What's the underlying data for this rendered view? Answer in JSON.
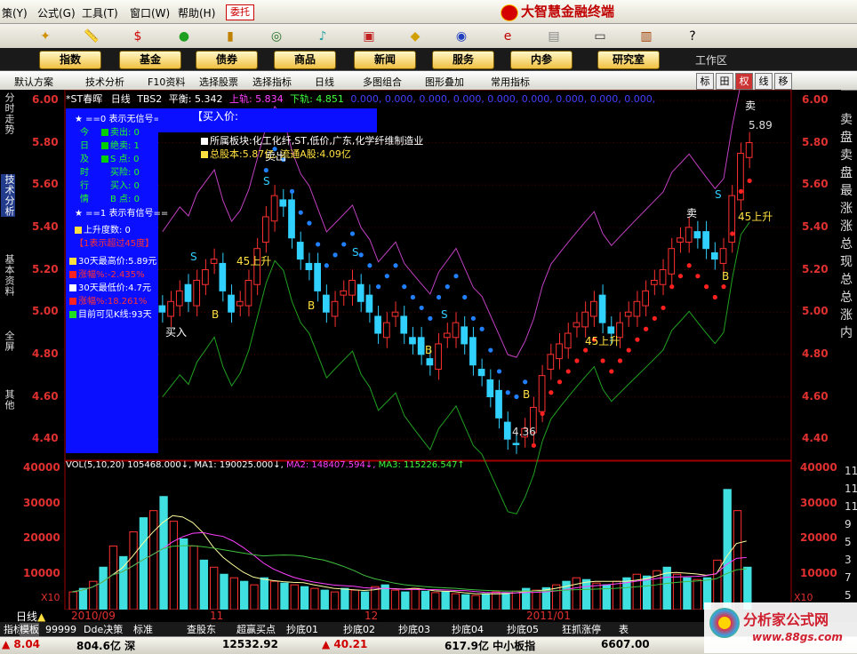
{
  "menubar": {
    "items": [
      "策(Y)",
      "公式(G)",
      "工具(T)",
      "窗口(W)",
      "帮助(H)"
    ],
    "entrust_label": "委托",
    "brand": "大智慧金融终端"
  },
  "toolbar": {
    "icons": [
      "nav-diamond",
      "ruler",
      "dollar-sign",
      "traffic-light",
      "bars-gold",
      "binoculars",
      "bell",
      "book",
      "diamond",
      "globe",
      "coin-e",
      "clipboard",
      "window",
      "books",
      "help-pointer"
    ]
  },
  "navbar": {
    "tabs": [
      "指数",
      "基金",
      "债券",
      "商品",
      "新闻",
      "服务",
      "内参",
      "研究室"
    ],
    "workspace_label": "工作区"
  },
  "subbar": {
    "items": [
      "默认方案",
      "技术分析",
      "F10资料",
      "选择股票",
      "选择指标",
      "日线",
      "多图组合",
      "图形叠加",
      "常用指标"
    ],
    "right_buttons": [
      "标",
      "田",
      "权",
      "线",
      "移"
    ]
  },
  "left_tabs": [
    "分时走势",
    "技术分析",
    "基本资料",
    "全屏",
    "其他"
  ],
  "main_chart": {
    "header": {
      "name": "*ST春晖",
      "period": "日线",
      "indicator": "TBS2",
      "avg_label": "平衡: 5.342",
      "upper_label": "上轨: 5.834",
      "lower_label": "下轨: 4.851",
      "zeros": "0.000, 0.000, 0.000, 0.000, 0.000, 0.000, 0.000, 0.000, 0.000,"
    },
    "y_ticks": [
      "6.00",
      "5.80",
      "5.60",
      "5.40",
      "5.20",
      "5.00",
      "4.80",
      "4.60",
      "4.40"
    ],
    "price_max_label": "5.89",
    "price_min_label": "4.36",
    "annotations": {
      "sell": "卖出",
      "buy": "买入",
      "rise45": "45上升",
      "sell_short": "卖",
      "buy_b": "B",
      "sell_s": "S"
    }
  },
  "info_box": {
    "line1": "★ ==0 表示无信号==",
    "left_chars": [
      "今",
      "日",
      "及",
      "时",
      "行",
      "情"
    ],
    "rows": [
      {
        "label": "卖出",
        "value": "0",
        "color": "#00d000"
      },
      {
        "label": "绝卖",
        "value": "1",
        "color": "#00d000"
      },
      {
        "label": "S 点",
        "value": "0",
        "color": "#00d000"
      },
      {
        "label": "买险",
        "value": "0",
        "color": "#0a10ff"
      },
      {
        "label": "买入",
        "value": "0",
        "color": "#0a10ff"
      },
      {
        "label": "B 点",
        "value": "0",
        "color": "#0a10ff"
      }
    ],
    "line2": "★ ==1 表示有信号==",
    "rise_degree": "上升度数: 0",
    "over45": "【1表示超过45度】",
    "high30": "30天最高价:5.89元",
    "up_pct": "涨幅%:-2.435%",
    "low30": "30天最低价:4.7元",
    "up_pct2": "涨幅%:18.261%",
    "visible_k": "目前可见K线:93天"
  },
  "buy_banner": {
    "title": "【买入价:",
    "sector": "所属板块:化工化纤,ST,低价,广东,化学纤维制造业",
    "equity": "总股本:5.87亿, 流通A股:4.09亿"
  },
  "volume_chart": {
    "header": {
      "vol": "VOL(5,10,20) 105468.000↓,",
      "ma1": "MA1: 190025.000↓,",
      "ma2": "MA2: 148407.594↓,",
      "ma3": "MA3: 115226.547↑"
    },
    "y_ticks": [
      "40000",
      "30000",
      "20000",
      "10000"
    ],
    "x10": "X10",
    "dates": [
      "2010/09",
      "11",
      "12",
      "2011/01"
    ],
    "right_values": [
      "11",
      "11",
      "11",
      "9",
      "5",
      "3",
      "7",
      "5"
    ]
  },
  "bottom_tabs": {
    "period": "日线",
    "tabs": [
      "指标",
      "模板",
      "99999",
      "Dde决策",
      "标准",
      "查股东",
      "超赢买点",
      "抄底01",
      "抄底02",
      "抄底03",
      "抄底04",
      "抄底05",
      "狂抓涨停",
      "表"
    ]
  },
  "right_panel": {
    "lines": [
      "卖",
      "盘",
      "卖",
      "盘",
      "最",
      "涨",
      "涨",
      "总",
      "现",
      "总",
      "总",
      "涨",
      "内"
    ]
  },
  "statusbar": {
    "items": [
      "▲ 8.04",
      "804.6亿 深",
      "12532.92",
      "▲ 40.21",
      "617.9亿 中小板指",
      "6607.00"
    ]
  },
  "watermark": {
    "site_name": "分析家公式网",
    "url": "www.88gs.com"
  },
  "chart_data": {
    "type": "candlestick",
    "title": "*ST春晖",
    "ylim": [
      4.3,
      6.05
    ],
    "x_labels": [
      "2010/09",
      "11",
      "12",
      "2011/01"
    ],
    "close_series": [
      5.0,
      5.05,
      5.1,
      5.05,
      5.15,
      5.2,
      5.25,
      5.1,
      5.0,
      5.05,
      5.15,
      5.3,
      5.45,
      5.55,
      5.5,
      5.35,
      5.25,
      5.2,
      5.1,
      5.0,
      5.05,
      5.1,
      5.15,
      5.05,
      5.0,
      4.9,
      4.95,
      5.0,
      4.9,
      4.85,
      4.8,
      4.75,
      4.85,
      4.9,
      4.95,
      4.85,
      4.75,
      4.7,
      4.6,
      4.5,
      4.4,
      4.38,
      4.45,
      4.55,
      4.7,
      4.8,
      4.85,
      4.9,
      4.95,
      5.0,
      5.05,
      4.95,
      4.9,
      4.95,
      5.0,
      5.05,
      5.1,
      5.15,
      5.2,
      5.3,
      5.35,
      5.4,
      5.35,
      5.3,
      5.25,
      5.3,
      5.55,
      5.75,
      5.8
    ],
    "volume_series": [
      5000,
      6000,
      8000,
      12000,
      18000,
      15000,
      22000,
      26000,
      28000,
      32000,
      25000,
      20000,
      18000,
      14000,
      12000,
      10000,
      9000,
      8000,
      7000,
      9000,
      8000,
      7500,
      7000,
      6500,
      6000,
      5500,
      5000,
      6000,
      5500,
      5000,
      6500,
      7000,
      5500,
      5000,
      6000,
      5200,
      4800,
      5000,
      4500,
      4200,
      4000,
      4500,
      5000,
      4800,
      5200,
      6000,
      5500,
      6200,
      7000,
      8000,
      9000,
      8500,
      7500,
      7000,
      8000,
      9000,
      10000,
      9500,
      11000,
      12000,
      10000,
      9000,
      8500,
      9000,
      14000,
      34000,
      28000,
      12000
    ]
  }
}
